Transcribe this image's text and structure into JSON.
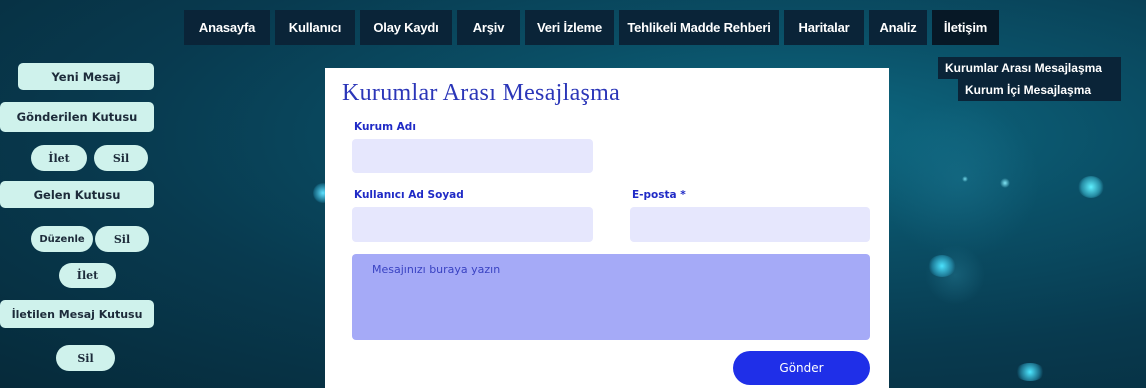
{
  "nav": {
    "items": [
      {
        "label": "Anasayfa"
      },
      {
        "label": "Kullanıcı"
      },
      {
        "label": "Olay Kaydı"
      },
      {
        "label": "Arşiv"
      },
      {
        "label": "Veri İzleme"
      },
      {
        "label": "Tehlikeli Madde Rehberi"
      },
      {
        "label": "Haritalar"
      },
      {
        "label": "Analiz"
      },
      {
        "label": "İletişim"
      }
    ],
    "active": "İletişim"
  },
  "dropdown": {
    "items": [
      {
        "label": "Kurumlar Arası Mesajlaşma"
      },
      {
        "label": "Kurum İçi Mesajlaşma"
      }
    ]
  },
  "sidebar": {
    "new_message": "Yeni Mesaj",
    "sent_box": "Gönderilen Kutusu",
    "sent_forward": "İlet",
    "sent_delete": "Sil",
    "inbox": "Gelen Kutusu",
    "inbox_edit": "Düzenle",
    "inbox_delete": "Sil",
    "inbox_forward": "İlet",
    "forwarded_box": "İletilen Mesaj Kutusu",
    "forwarded_delete": "Sil"
  },
  "form": {
    "title": "Kurumlar Arası Mesajlaşma",
    "institution_label": "Kurum Adı",
    "institution_value": "",
    "name_label": "Kullanıcı Ad Soyad",
    "name_value": "",
    "email_label": "E-posta *",
    "email_value": "",
    "message_placeholder": "Mesajınızı buraya yazın",
    "send_label": "Gönder"
  },
  "colors": {
    "nav_bg": "#0a2438",
    "sidebar_button": "#cff2ec",
    "accent": "#1f2fe8",
    "message_box": "#a5aaf7",
    "field_bg": "#e6e7fd"
  }
}
